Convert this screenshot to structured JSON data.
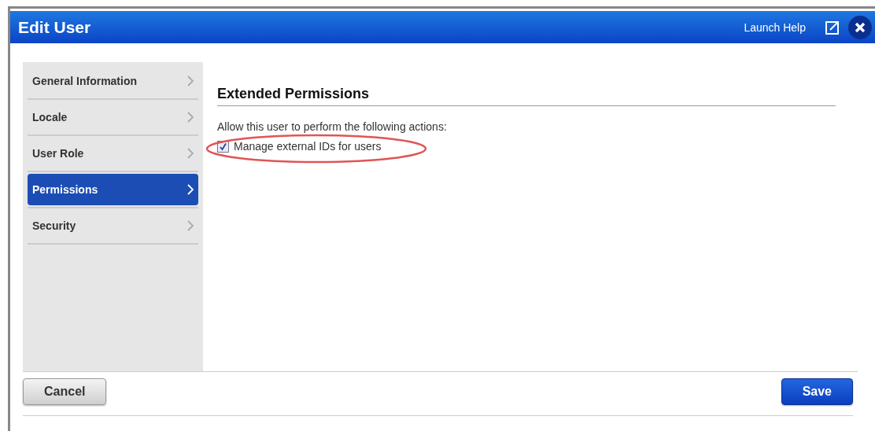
{
  "window": {
    "title": "Edit User",
    "help_link": "Launch Help"
  },
  "sidebar": {
    "items": [
      {
        "label": "General Information",
        "selected": false
      },
      {
        "label": "Locale",
        "selected": false
      },
      {
        "label": "User Role",
        "selected": false
      },
      {
        "label": "Permissions",
        "selected": true
      },
      {
        "label": "Security",
        "selected": false
      }
    ]
  },
  "section": {
    "title": "Extended Permissions",
    "description": "Allow this user to perform the following actions:",
    "options": [
      {
        "label": "Manage external IDs for users",
        "checked": true,
        "highlighted": true
      }
    ]
  },
  "buttons": {
    "cancel": "Cancel",
    "save": "Save"
  }
}
